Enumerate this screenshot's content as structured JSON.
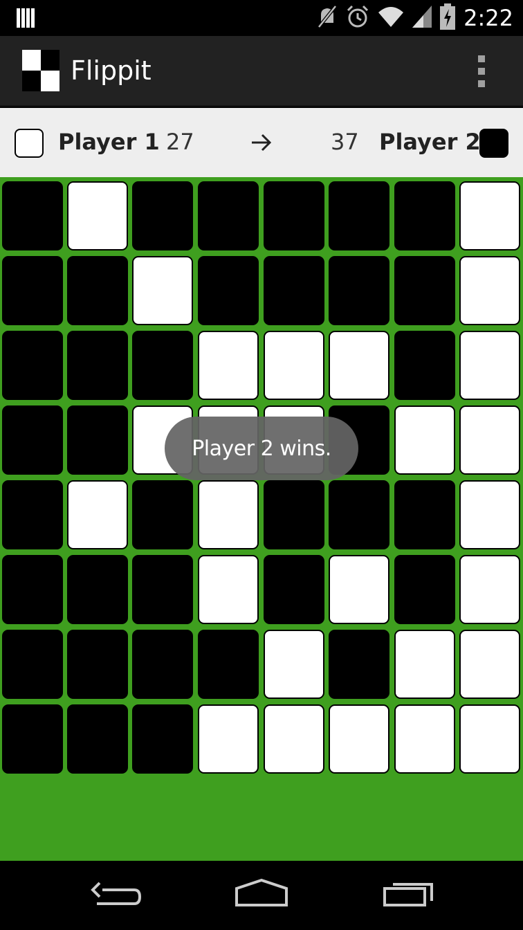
{
  "status_bar": {
    "time": "2:22",
    "icons": [
      "notification-bars-icon",
      "mute-icon",
      "alarm-icon",
      "wifi-icon",
      "signal-icon",
      "battery-charging-icon"
    ]
  },
  "app_bar": {
    "title": "Flippit",
    "icon": "flippit-logo-icon",
    "overflow_icon": "overflow-menu-icon"
  },
  "scoreboard": {
    "player1": {
      "name": "Player 1",
      "score": "27",
      "color": "#ffffff"
    },
    "player2": {
      "name": "Player 2",
      "score": "37",
      "color": "#000000"
    },
    "turn_icon": "right-arrow-icon"
  },
  "board": {
    "rows": 8,
    "cols": 8,
    "background_color": "#3f9f1f",
    "cells": [
      [
        "black",
        "white",
        "black",
        "black",
        "black",
        "black",
        "black",
        "white"
      ],
      [
        "black",
        "black",
        "white",
        "black",
        "black",
        "black",
        "black",
        "white"
      ],
      [
        "black",
        "black",
        "black",
        "white",
        "white",
        "white",
        "black",
        "white"
      ],
      [
        "black",
        "black",
        "white",
        "white",
        "white",
        "black",
        "white",
        "white"
      ],
      [
        "black",
        "white",
        "black",
        "white",
        "black",
        "black",
        "black",
        "white"
      ],
      [
        "black",
        "black",
        "black",
        "white",
        "black",
        "white",
        "black",
        "white"
      ],
      [
        "black",
        "black",
        "black",
        "black",
        "white",
        "black",
        "white",
        "white"
      ],
      [
        "black",
        "black",
        "black",
        "white",
        "white",
        "white",
        "white",
        "white"
      ]
    ]
  },
  "toast": {
    "message": "Player 2 wins."
  },
  "nav_bar": {
    "buttons": [
      {
        "name": "back-button",
        "icon": "back-icon"
      },
      {
        "name": "home-button",
        "icon": "home-icon"
      },
      {
        "name": "recents-button",
        "icon": "recents-icon"
      }
    ]
  }
}
